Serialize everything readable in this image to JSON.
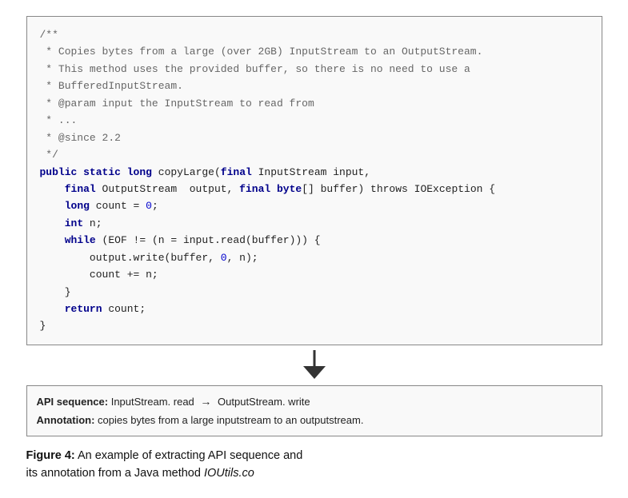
{
  "code": {
    "comment_lines": [
      "/**",
      " * Copies bytes from a large (over 2GB) InputStream to an OutputStream.",
      " * This method uses the provided buffer, so there is no need to use a",
      " * BufferedInputStream.",
      " * @param input the InputStream to read from",
      " * ...",
      " * @since 2.2",
      " */"
    ],
    "signature_line1": "public static long copyLarge(final InputStream input,",
    "signature_line2": "    final OutputStream  output, final byte[] buffer) throws IOException {",
    "body_lines": [
      "    long count = 0;",
      "    int n;",
      "    while (EOF != (n = input.read(buffer))) {",
      "        output.write(buffer, 0, n);",
      "        count += n;",
      "    }",
      "    return count;",
      "}"
    ]
  },
  "annotation": {
    "api_label": "API sequence:",
    "api_text": "InputStream. read",
    "arrow": "→",
    "api_text2": "OutputStream. write",
    "annotation_label": "Annotation:",
    "annotation_text": "copies bytes from a large inputstream to an outputstream."
  },
  "figure": {
    "label": "Figure 4:",
    "text": " An example of extracting API sequence and",
    "line2_prefix": "its annotation from a Java method ",
    "line2_italic": "IOUtils.co",
    "line2_suffix": ""
  }
}
